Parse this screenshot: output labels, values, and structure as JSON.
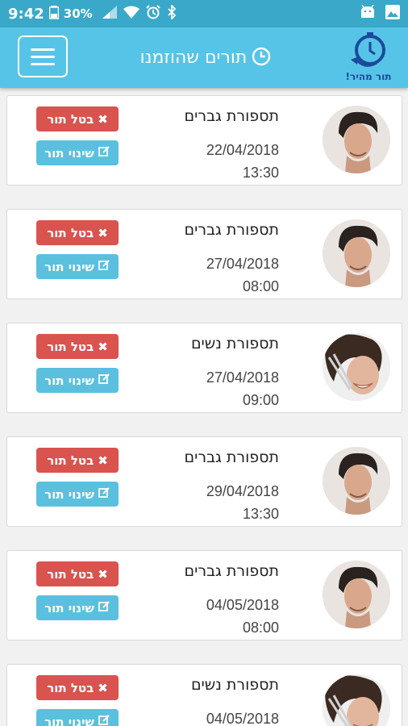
{
  "status_bar": {
    "time": "9:42",
    "battery": "30%",
    "icons": [
      "sim-icon",
      "battery-icon",
      "signal-icon",
      "wifi-icon",
      "alarm-icon",
      "bluetooth-icon",
      "android-icon",
      "image-icon"
    ]
  },
  "header": {
    "title": "תורים שהוזמנו",
    "logo_text": "תור מהיר!",
    "menu_icon": "hamburger-icon",
    "title_icon": "clock-icon"
  },
  "colors": {
    "status_bar": "#3aa9c9",
    "app_bar": "#56c4e6",
    "cancel": "#d9534f",
    "change": "#5bc0de",
    "logo": "#1a4a9c"
  },
  "buttons": {
    "cancel_label": "בטל תור",
    "change_label": "שינוי תור",
    "cancel_icon": "close-icon",
    "change_icon": "edit-icon"
  },
  "appointments": [
    {
      "service": "תספורת גברים",
      "date": "22/04/2018",
      "time": "13:30",
      "avatar": "man-avatar"
    },
    {
      "service": "תספורת גברים",
      "date": "27/04/2018",
      "time": "08:00",
      "avatar": "man-avatar"
    },
    {
      "service": "תספורת נשים",
      "date": "27/04/2018",
      "time": "09:00",
      "avatar": "woman-avatar"
    },
    {
      "service": "תספורת גברים",
      "date": "29/04/2018",
      "time": "13:30",
      "avatar": "man-avatar"
    },
    {
      "service": "תספורת גברים",
      "date": "04/05/2018",
      "time": "08:00",
      "avatar": "man-avatar"
    },
    {
      "service": "תספורת נשים",
      "date": "04/05/2018",
      "time": "",
      "avatar": "woman-avatar"
    }
  ]
}
